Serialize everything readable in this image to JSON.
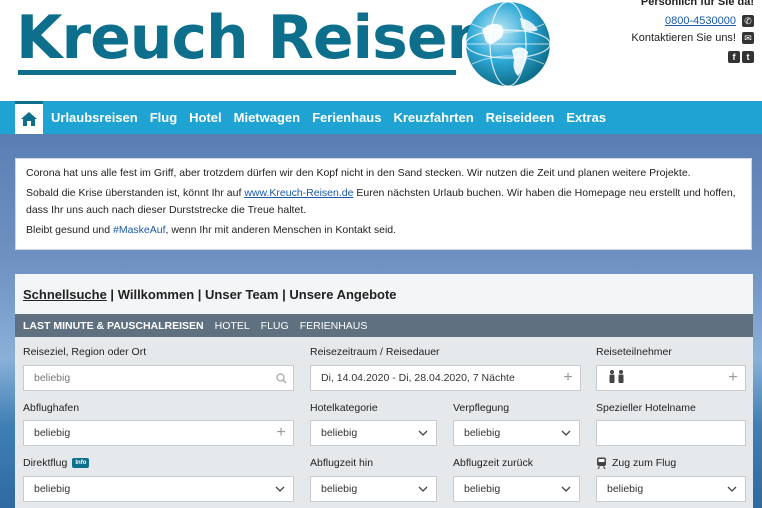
{
  "header": {
    "logo_text": "Kreuch Reisen",
    "tagline": "Persönlich für Sie da!",
    "phone": "0800-4530000",
    "contact_label": "Kontaktieren Sie uns!",
    "social_icons": [
      "facebook-icon",
      "twitter-icon"
    ],
    "brand_color": "#0e6f8c"
  },
  "nav": {
    "home_icon": "home-icon",
    "items": [
      "Urlaubsreisen",
      "Flug",
      "Hotel",
      "Mietwagen",
      "Ferienhaus",
      "Kreuzfahrten",
      "Reiseideen",
      "Extras"
    ],
    "color": "#1ea3d3"
  },
  "notice": {
    "line1": "Corona hat uns alle fest im Griff, aber trotzdem dürfen wir den Kopf nicht in den Sand stecken. Wir nutzen die Zeit und planen weitere Projekte.",
    "line2_pre": "Sobald die Krise überstanden ist, könnt Ihr auf ",
    "line2_link": "www.Kreuch-Reisen.de",
    "line2_post": " Euren nächsten Urlaub buchen. Wir haben die Homepage neu erstellt und hoffen, dass Ihr uns auch nach dieser Durststrecke die Treue haltet.",
    "line3_pre": "Bleibt gesund und ",
    "line3_tag": "#MaskeAuf",
    "line3_post": ", wenn Ihr mit anderen Menschen in Kontakt seid."
  },
  "panel": {
    "head": {
      "quick": "Schnellsuche",
      "sep": " | ",
      "welcome": "Willkommen",
      "team": "Unser Team",
      "offers": "Unsere Angebote"
    },
    "tabs": [
      "LAST MINUTE & PAUSCHALREISEN",
      "HOTEL",
      "FLUG",
      "FERIENHAUS"
    ],
    "fields": {
      "destination": {
        "label": "Reiseziel, Region oder Ort",
        "placeholder": "beliebig"
      },
      "period": {
        "label": "Reisezeitraum / Reisedauer",
        "value": "Di, 14.04.2020 - Di, 28.04.2020, 7 Nächte"
      },
      "travelers": {
        "label": "Reiseteilnehmer"
      },
      "airport": {
        "label": "Abflughafen",
        "value": "beliebig"
      },
      "hotel_category": {
        "label": "Hotelkategorie",
        "value": "beliebig"
      },
      "board": {
        "label": "Verpflegung",
        "value": "beliebig"
      },
      "hotel_name": {
        "label": "Spezieller Hotelname",
        "value": ""
      },
      "direct_flight": {
        "label": "Direktflug",
        "badge": "Info",
        "value": "beliebig"
      },
      "departure_out": {
        "label": "Abflugzeit hin",
        "value": "beliebig"
      },
      "departure_back": {
        "label": "Abflugzeit zurück",
        "value": "beliebig"
      },
      "train": {
        "label": "Zug zum Flug",
        "icon": "train-icon",
        "value": "beliebig"
      }
    }
  }
}
